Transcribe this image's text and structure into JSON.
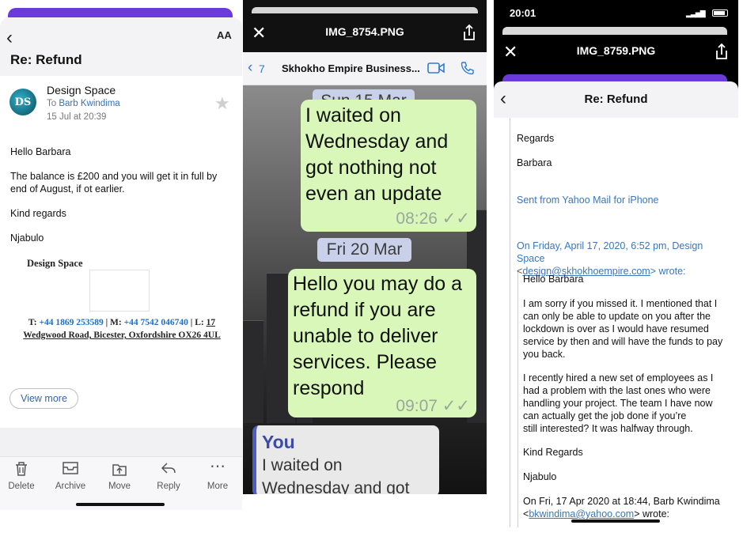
{
  "panel1": {
    "subject": "Re: Refund",
    "aa_label": "AA",
    "avatar_initials": "DS",
    "sender": "Design Space",
    "to_prefix": "To",
    "to_name": "Barb Kwindima",
    "date": "15 Jul at 20:39",
    "body": [
      "Hello Barbara",
      "The balance is £200 and you will get it in full by end of August, if ot earlier.",
      "Kind regards",
      "Njabulo"
    ],
    "signature_company": "Design Space",
    "contact": {
      "t_label": "T:",
      "t_value": "+44 1869 253589",
      "m_label": "| M:",
      "m_value": "+44 7542 046740",
      "l_label": "| L:",
      "l_value_line1": "17",
      "address": "Wedgwood Road, Bicester, Oxfordshire OX26 4UL"
    },
    "view_more": "View more",
    "toolbar": [
      {
        "icon": "trash-icon",
        "label": "Delete"
      },
      {
        "icon": "archive-icon",
        "label": "Archive"
      },
      {
        "icon": "move-icon",
        "label": "Move"
      },
      {
        "icon": "reply-icon",
        "label": "Reply"
      },
      {
        "icon": "more-icon",
        "label": "More"
      }
    ]
  },
  "panel2": {
    "title": "IMG_8754.PNG",
    "back_count": "7",
    "chat_name": "Skhokho Empire Business...",
    "date1": "Sun 15 Mar",
    "msg1_lines": [
      "I waited on",
      "Wednesday and",
      "got nothing not",
      "even an update"
    ],
    "msg1_time": "08:26",
    "date2": "Fri 20 Mar",
    "msg2_lines": [
      "Hello you may do a",
      "refund if you are",
      "unable to deliver",
      "services. Please",
      "respond"
    ],
    "msg2_time": "09:07",
    "reply_author": "You",
    "reply_lines": [
      "I waited on",
      "Wednesday and got"
    ],
    "colors": {
      "bubble": "#d8f7b9",
      "accent": "#2e7bd6"
    }
  },
  "panel3": {
    "status_time": "20:01",
    "title": "IMG_8759.PNG",
    "mail_subject": "Re: Refund",
    "regards": "Regards",
    "name": "Barbara",
    "sent_from": "Sent from Yahoo Mail for iPhone",
    "quote_header1": "On Friday, April 17, 2020, 6:52 pm, Design Space",
    "quote_email1": "design@skhokhoempire.com",
    "quote_wrote1": "> wrote:",
    "q_hello": "Hello Barbara",
    "q_p1": [
      "I am sorry if you missed it. I mentioned that I",
      "can only be able to update on you after the",
      "lockdown is over as I would have resumed",
      "service by then and will have the funds to pay",
      "you back."
    ],
    "q_p2": [
      "I recently hired a new set of employees as I",
      "had a problem with the last ones who were",
      "handling your project. The team I have now",
      "can actually get the job done if you’re",
      "still interested? It was halfway through."
    ],
    "q_kind": "Kind Regards",
    "q_name": "Njabulo",
    "quote_header2": "On Fri, 17 Apr 2020 at 18:44, Barb Kwindima",
    "quote_email2": "bkwindima@yahoo.com",
    "quote_wrote2": "> wrote:"
  }
}
